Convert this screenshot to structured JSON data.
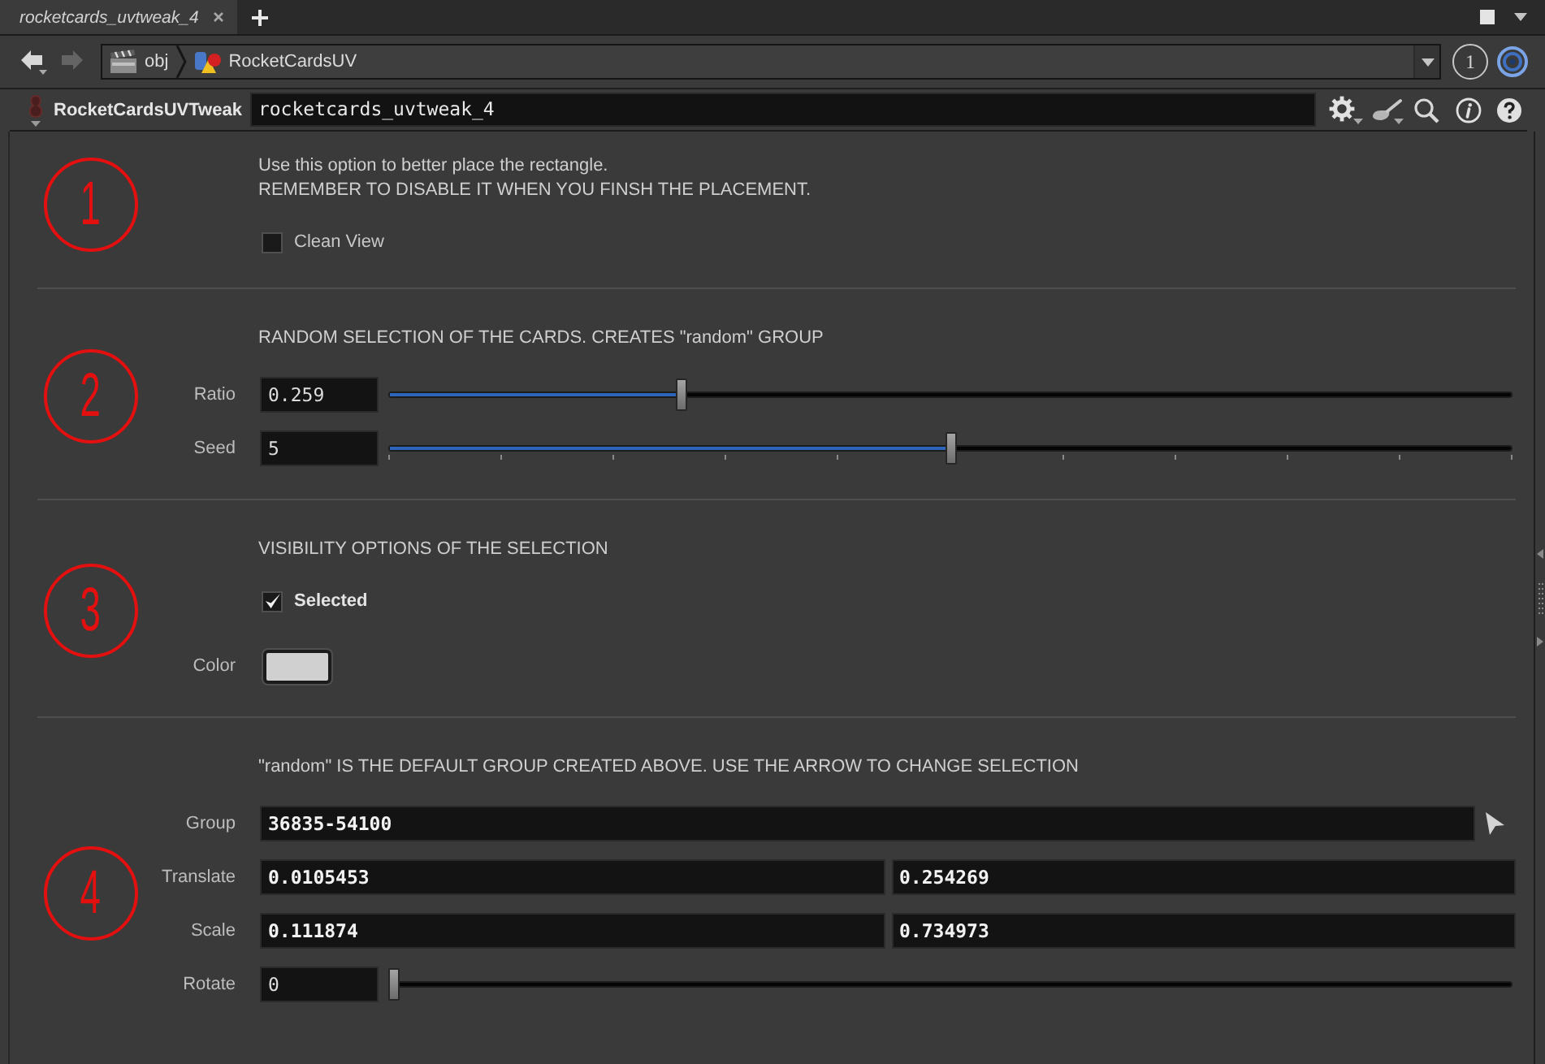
{
  "tabs": [
    {
      "label": "rocketcards_uvtweak_4",
      "selected": true
    }
  ],
  "history": [
    {
      "kind": "back",
      "disabled": false
    },
    {
      "kind": "forward",
      "disabled": true
    }
  ],
  "path": [
    {
      "kind": "network",
      "label": "obj"
    },
    {
      "kind": "object",
      "label": "RocketCardsUV"
    }
  ],
  "link_group": "1",
  "node": {
    "type": "RocketCardsUVTweak",
    "name": "rocketcards_uvtweak_4"
  },
  "sections": [
    {
      "marker": "1",
      "notes": [
        "Use this option to better place the rectangle.",
        "REMEMBER TO DISABLE IT WHEN YOU FINSH THE PLACEMENT."
      ],
      "params": [
        {
          "kind": "toggle",
          "label": "Clean View",
          "checked": false,
          "modified": false
        }
      ]
    },
    {
      "marker": "2",
      "notes": [
        "RANDOM SELECTION OF THE CARDS. CREATES \"random\" GROUP"
      ],
      "params": [
        {
          "kind": "slider",
          "label": "Ratio",
          "value": "0.259",
          "level": 0.259,
          "ticks": false,
          "modified": false
        },
        {
          "kind": "slider",
          "label": "Seed",
          "value": "5",
          "level": 0.5,
          "ticks": true,
          "modified": false
        }
      ]
    },
    {
      "marker": "3",
      "notes": [
        "VISIBILITY OPTIONS OF THE SELECTION"
      ],
      "params": [
        {
          "kind": "toggle",
          "label": "Selected",
          "checked": true,
          "modified": true
        },
        {
          "kind": "color",
          "label": "Color",
          "color": "#d0d0d0"
        }
      ]
    },
    {
      "marker": "4",
      "notes": [
        "\"random\" IS THE DEFAULT GROUP CREATED ABOVE. USE THE ARROW TO CHANGE SELECTION"
      ],
      "params": [
        {
          "kind": "group",
          "label": "Group",
          "value": "36835-54100",
          "modified": true
        },
        {
          "kind": "vector",
          "label": "Translate",
          "values": [
            "0.0105453",
            "0.254269"
          ],
          "modified": true
        },
        {
          "kind": "vector",
          "label": "Scale",
          "values": [
            "0.111874",
            "0.734973"
          ],
          "modified": true
        },
        {
          "kind": "slider",
          "label": "Rotate",
          "value": "0",
          "level": 0,
          "ticks": false,
          "modified": false
        }
      ]
    }
  ]
}
